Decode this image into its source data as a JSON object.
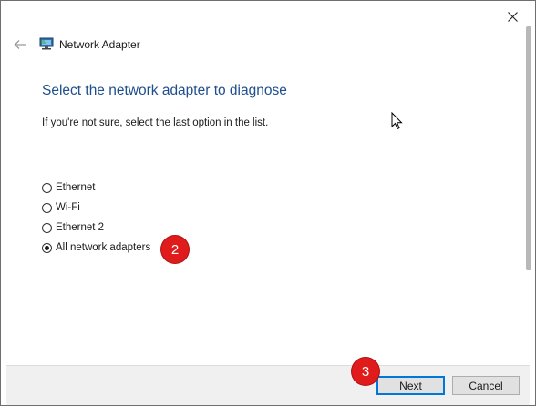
{
  "header": {
    "title": "Network Adapter",
    "back_icon": "back-arrow-icon",
    "app_icon": "network-adapter-icon",
    "close_icon": "close-icon"
  },
  "main": {
    "heading": "Select the network adapter to diagnose",
    "description": "If you're not sure, select the last option in the list.",
    "options": [
      {
        "label": "Ethernet",
        "selected": false
      },
      {
        "label": "Wi-Fi",
        "selected": false
      },
      {
        "label": "Ethernet 2",
        "selected": false
      },
      {
        "label": "All network adapters",
        "selected": true
      }
    ]
  },
  "annotations": {
    "step_2": "2",
    "step_3": "3",
    "badge_color": "#e01b1b"
  },
  "footer": {
    "next_label": "Next",
    "cancel_label": "Cancel"
  },
  "colors": {
    "heading": "#1e4e8c",
    "accent": "#0078d7"
  }
}
